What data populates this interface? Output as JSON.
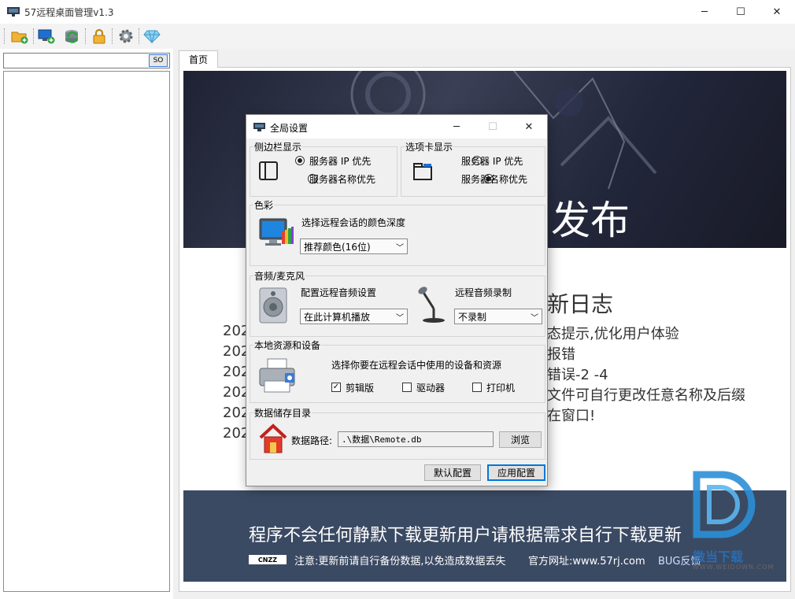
{
  "window": {
    "title": "57远程桌面管理v1.3",
    "controls": {
      "minimize": "─",
      "maximize": "☐",
      "close": "✕"
    }
  },
  "toolbar": {
    "buttons": [
      "add-folder-icon",
      "add-server-icon",
      "sync-icon",
      "lock-icon",
      "gear-icon",
      "diamond-icon"
    ]
  },
  "sidebar": {
    "search_value": "",
    "search_button": "SO"
  },
  "tabs": [
    {
      "label": "首页"
    }
  ],
  "home": {
    "banner_text": "发布",
    "log_title": "新日志",
    "log_years": [
      "202",
      "202",
      "202",
      "202",
      "202",
      "202"
    ],
    "log_lines": [
      "态提示,优化用户体验",
      "报错",
      "错误-2 -4",
      "文件可自行更改任意名称及后缀",
      "在窗口!"
    ],
    "footer_main": "程序不会任何静默下载更新用户请根据需求自行下载更新",
    "cnzz": "CNZZ",
    "footer_note": "注意:更新前请自行备份数据,以免造成数据丢失",
    "footer_site": "官方网址:www.57rj.com",
    "footer_bug": "BUG反馈"
  },
  "watermark": {
    "text": "微当下载",
    "url": "WWW.WEIDOWN.COM"
  },
  "dialog": {
    "title": "全局设置",
    "sidebar_group": {
      "title": "侧边栏显示",
      "options": [
        "服务器 IP 优先",
        "服务器名称优先"
      ],
      "selected": 0
    },
    "tab_group": {
      "title": "选项卡显示",
      "options": [
        "服务器 IP 优先",
        "服务器名称优先"
      ],
      "selected": 1
    },
    "color_group": {
      "title": "色彩",
      "label": "选择远程会话的颜色深度",
      "value": "推荐颜色(16位)"
    },
    "audio_group": {
      "title": "音频/麦克风",
      "playback_label": "配置远程音频设置",
      "playback_value": "在此计算机播放",
      "record_label": "远程音频录制",
      "record_value": "不录制"
    },
    "devices_group": {
      "title": "本地资源和设备",
      "label": "选择你要在远程会话中使用的设备和资源",
      "items": [
        {
          "label": "剪辑版",
          "checked": true
        },
        {
          "label": "驱动器",
          "checked": false
        },
        {
          "label": "打印机",
          "checked": false
        }
      ]
    },
    "storage_group": {
      "title": "数据储存目录",
      "path_label": "数据路径:",
      "path_value": ".\\数据\\Remote.db",
      "browse": "浏览"
    },
    "buttons": {
      "default": "默认配置",
      "apply": "应用配置"
    }
  }
}
